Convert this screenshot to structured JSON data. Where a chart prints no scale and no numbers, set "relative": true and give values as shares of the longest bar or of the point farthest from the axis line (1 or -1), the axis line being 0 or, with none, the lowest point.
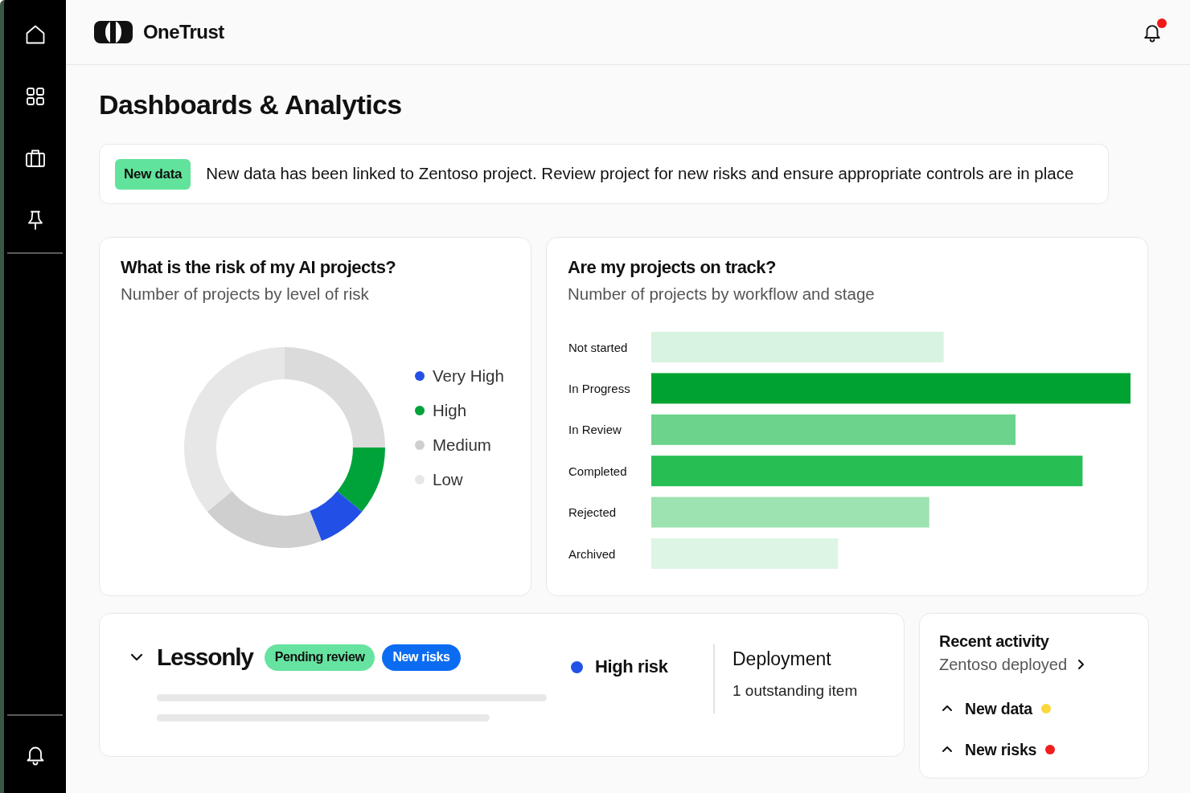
{
  "header": {
    "brand": "OneTrust",
    "unread": true
  },
  "page_title": "Dashboards & Analytics",
  "banner": {
    "badge": "New data",
    "message": "New data has been linked to Zentoso project. Review project for new risks and ensure appropriate controls are in place"
  },
  "risk_card": {
    "title": "What is the risk of my AI projects?",
    "subtitle": "Number of projects by level of risk",
    "chart_data": {
      "type": "donut",
      "values": [
        25,
        11,
        8,
        20,
        36
      ],
      "colors": [
        "#dbdbdb",
        "#00a33a",
        "#2250e6",
        "#cfcfcf",
        "#e7e7e7"
      ]
    },
    "legend": [
      {
        "label": "Very High",
        "color": "#2250e6"
      },
      {
        "label": "High",
        "color": "#00a33a"
      },
      {
        "label": "Medium",
        "color": "#cfcfcf"
      },
      {
        "label": "Low",
        "color": "#e7e7e7"
      }
    ]
  },
  "track_card": {
    "title": "Are my projects on track?",
    "subtitle": "Number of projects by workflow and stage",
    "chart_data": {
      "type": "bar",
      "orientation": "horizontal",
      "relative": true,
      "categories": [
        "Not started",
        "In Progress",
        "In Review",
        "Completed",
        "Rejected",
        "Archived"
      ],
      "values": [
        0.61,
        1,
        0.76,
        0.9,
        0.58,
        0.39
      ],
      "colors": [
        "#d8f3e0",
        "#00a332",
        "#6bd38b",
        "#27bf54",
        "#9de2b1",
        "#ddf5e5"
      ]
    }
  },
  "project_card": {
    "expanded": true,
    "name": "Lessonly",
    "badges": [
      {
        "label": "Pending review",
        "kind": "pending"
      },
      {
        "label": "New risks",
        "kind": "risks"
      }
    ],
    "risk": {
      "label": "High risk",
      "color": "#2251e6"
    },
    "stage": {
      "title": "Deployment",
      "detail": "1 outstanding item"
    }
  },
  "recent_activity": {
    "title": "Recent activity",
    "link": "Zentoso deployed",
    "items": [
      {
        "label": "New data",
        "expanded": true,
        "color": "#fbd83a"
      },
      {
        "label": "New risks",
        "expanded": true,
        "color": "#f21d1d"
      }
    ]
  }
}
